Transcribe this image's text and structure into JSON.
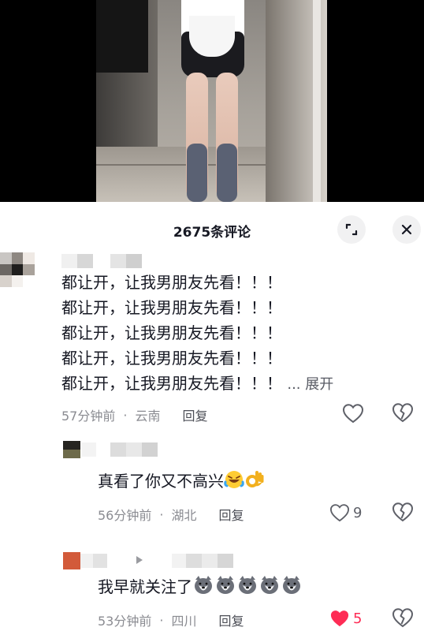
{
  "header": {
    "comment_count": "2675条评论"
  },
  "icons": {
    "expand": "expand-icon",
    "close": "close-icon",
    "heart": "heart-icon",
    "dislike": "broken-heart-icon",
    "arrow": "triangle-right-icon"
  },
  "colors": {
    "accent_red": "#fe2c55",
    "meta_grey": "#8a8b91"
  },
  "comments": [
    {
      "lines": [
        "都让开，让我男朋友先看！！！",
        "都让开，让我男朋友先看！！！",
        "都让开，让我男朋友先看！！！",
        "都让开，让我男朋友先看！！！",
        "都让开，让我男朋友先看！！！"
      ],
      "expand_label": "... 展开",
      "time": "57分钟前",
      "location": "云南",
      "reply_label": "回复",
      "likes": ""
    },
    {
      "text": "真看了你又不高兴",
      "time": "56分钟前",
      "location": "湖北",
      "reply_label": "回复",
      "likes": "9"
    },
    {
      "text": "我早就关注了",
      "time": "53分钟前",
      "location": "四川",
      "reply_label": "回复",
      "likes": "5",
      "liked": true
    }
  ]
}
